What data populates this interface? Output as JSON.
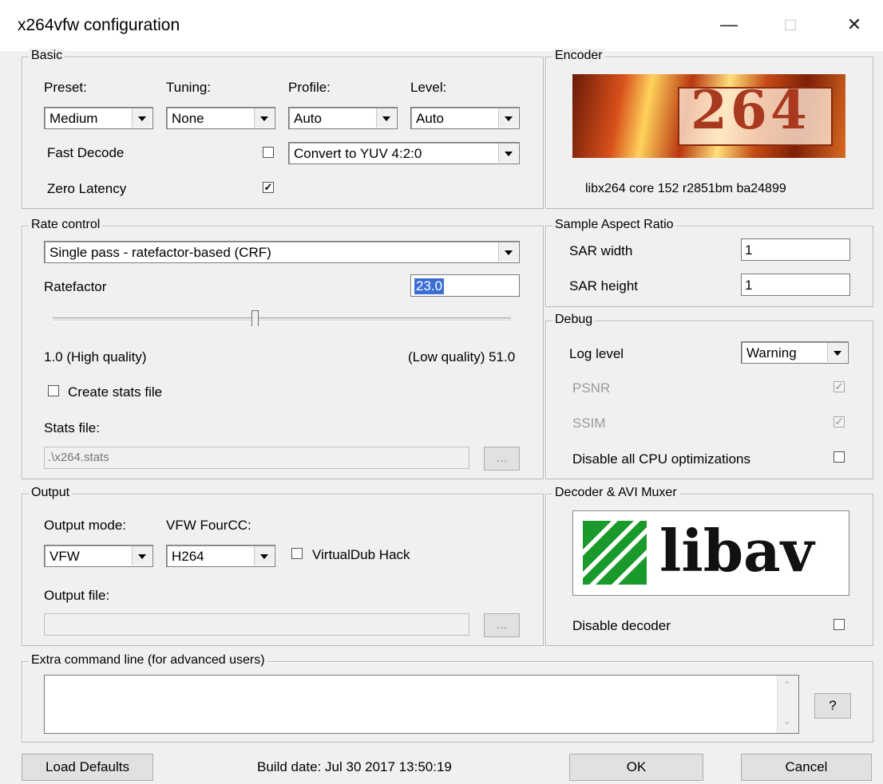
{
  "window": {
    "title": "x264vfw configuration",
    "minimize": "—",
    "maximize": "□",
    "close": "✕"
  },
  "basic": {
    "legend": "Basic",
    "preset_label": "Preset:",
    "preset_value": "Medium",
    "tuning_label": "Tuning:",
    "tuning_value": "None",
    "profile_label": "Profile:",
    "profile_value": "Auto",
    "level_label": "Level:",
    "level_value": "Auto",
    "fast_decode_label": "Fast Decode",
    "fast_decode_checked": "",
    "colorspace_value": "Convert to YUV 4:2:0",
    "zero_latency_label": "Zero Latency",
    "zero_latency_checked": "✓"
  },
  "encoder": {
    "legend": "Encoder",
    "logo_text": "264",
    "version": "libx264 core 152 r2851bm ba24899"
  },
  "rate_control": {
    "legend": "Rate control",
    "mode_value": "Single pass - ratefactor-based (CRF)",
    "ratefactor_label": "Ratefactor",
    "ratefactor_value": "23.0",
    "slider_value": 23.0,
    "slider_min": 1.0,
    "slider_max": 51.0,
    "min_label": "1.0 (High quality)",
    "max_label": "(Low quality) 51.0",
    "create_stats_label": "Create stats file",
    "stats_file_label": "Stats file:",
    "stats_file_value": ".\\x264.stats",
    "browse_label": "..."
  },
  "sar": {
    "legend": "Sample Aspect Ratio",
    "width_label": "SAR width",
    "width_value": "1",
    "height_label": "SAR height",
    "height_value": "1"
  },
  "debug": {
    "legend": "Debug",
    "log_level_label": "Log level",
    "log_level_value": "Warning",
    "psnr_label": "PSNR",
    "psnr_checked": "✓",
    "ssim_label": "SSIM",
    "ssim_checked": "✓",
    "disable_cpu_label": "Disable all CPU optimizations"
  },
  "output": {
    "legend": "Output",
    "mode_label": "Output mode:",
    "mode_value": "VFW",
    "fourcc_label": "VFW FourCC:",
    "fourcc_value": "H264",
    "vdub_label": "VirtualDub Hack",
    "file_label": "Output file:",
    "file_value": "",
    "browse_label": "..."
  },
  "decoder": {
    "legend": "Decoder & AVI Muxer",
    "logo_text": "libav",
    "disable_label": "Disable decoder"
  },
  "extra": {
    "legend": "Extra command line (for advanced users)",
    "value": "",
    "help_label": "?"
  },
  "footer": {
    "load_defaults": "Load Defaults",
    "build_date": "Build date: Jul 30 2017 13:50:19",
    "ok": "OK",
    "cancel": "Cancel"
  }
}
